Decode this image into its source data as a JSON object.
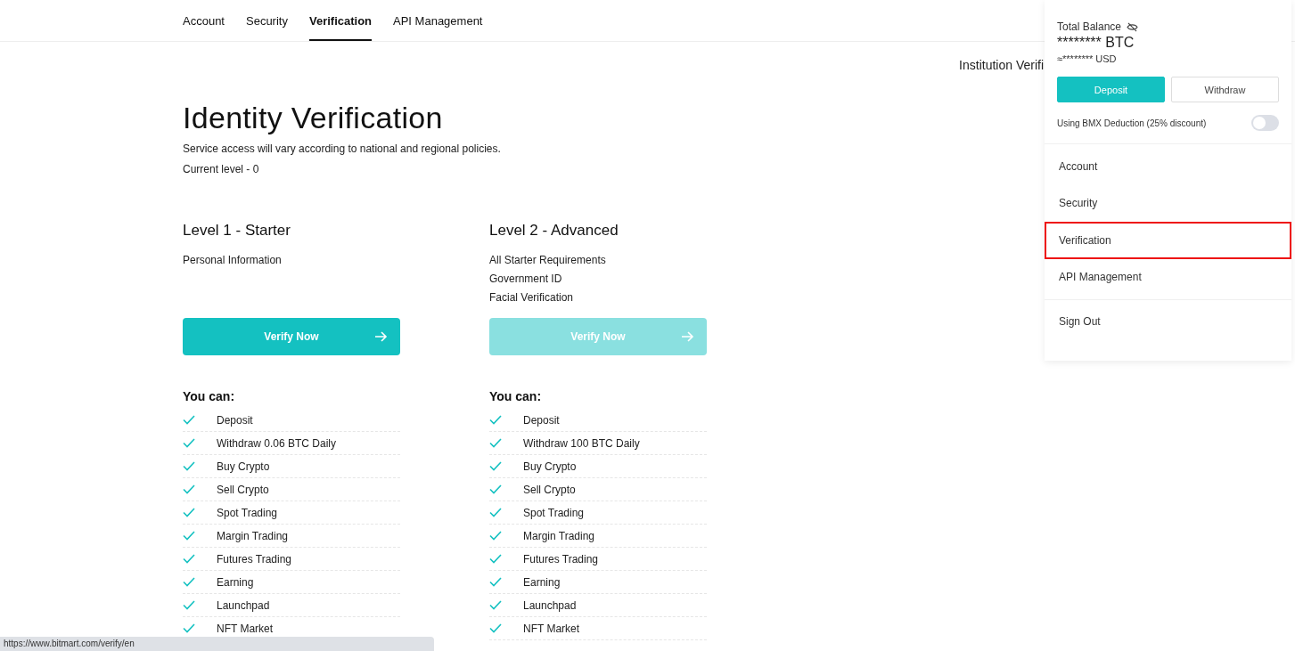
{
  "tabs": [
    {
      "label": "Account",
      "selected": false
    },
    {
      "label": "Security",
      "selected": false
    },
    {
      "label": "Verification",
      "selected": true
    },
    {
      "label": "API Management",
      "selected": false
    }
  ],
  "institution_link": "Institution Verifi",
  "heading": "Identity Verification",
  "subtitle": "Service access will vary according to national and regional policies.",
  "current_level": "Current level - 0",
  "levels": [
    {
      "title": "Level 1 - Starter",
      "requirements": [
        "Personal Information"
      ],
      "button": {
        "label": "Verify Now",
        "disabled": false
      },
      "you_can": "You can:",
      "features": [
        "Deposit",
        "Withdraw 0.06 BTC Daily",
        "Buy Crypto",
        "Sell Crypto",
        "Spot Trading",
        "Margin Trading",
        "Futures Trading",
        "Earning",
        "Launchpad",
        "NFT Market"
      ]
    },
    {
      "title": "Level 2 - Advanced",
      "requirements": [
        "All Starter Requirements",
        "Government ID",
        "Facial Verification"
      ],
      "button": {
        "label": "Verify Now",
        "disabled": true
      },
      "you_can": "You can:",
      "features": [
        "Deposit",
        "Withdraw 100 BTC Daily",
        "Buy Crypto",
        "Sell Crypto",
        "Spot Trading",
        "Margin Trading",
        "Futures Trading",
        "Earning",
        "Launchpad",
        "NFT Market"
      ]
    }
  ],
  "dropdown": {
    "balance_label": "Total Balance",
    "btc": "******** BTC",
    "usd": "≈******** USD",
    "deposit": "Deposit",
    "withdraw": "Withdraw",
    "deduction": {
      "label": "Using BMX Deduction (25% discount)",
      "on": false
    },
    "menu": [
      {
        "label": "Account",
        "highlighted": false
      },
      {
        "label": "Security",
        "highlighted": false
      },
      {
        "label": "Verification",
        "highlighted": true
      },
      {
        "label": "API Management",
        "highlighted": false
      }
    ],
    "sign_out": "Sign Out"
  },
  "status_bar": "https://www.bitmart.com/verify/en"
}
